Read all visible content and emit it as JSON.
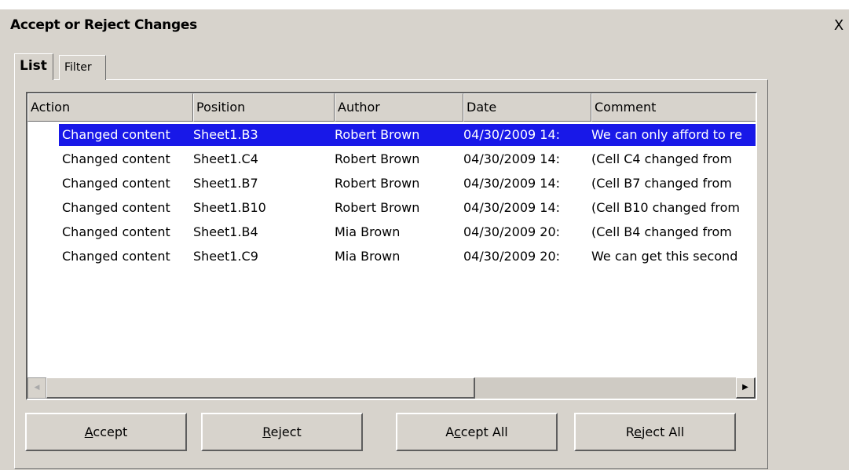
{
  "window": {
    "title": "Accept or Reject Changes",
    "close_glyph": "X"
  },
  "tabs": [
    {
      "label": "List",
      "active": true
    },
    {
      "label": "Filter",
      "active": false
    }
  ],
  "table": {
    "columns": [
      "Action",
      "Position",
      "Author",
      "Date",
      "Comment"
    ],
    "rows": [
      {
        "action": "Changed content",
        "position": "Sheet1.B3",
        "author": "Robert Brown",
        "date": "04/30/2009 14:",
        "comment": "We can only afford to re",
        "selected": true
      },
      {
        "action": "Changed content",
        "position": "Sheet1.C4",
        "author": "Robert Brown",
        "date": "04/30/2009 14:",
        "comment": "(Cell C4 changed from",
        "selected": false
      },
      {
        "action": "Changed content",
        "position": "Sheet1.B7",
        "author": "Robert Brown",
        "date": "04/30/2009 14:",
        "comment": "(Cell B7 changed from",
        "selected": false
      },
      {
        "action": "Changed content",
        "position": "Sheet1.B10",
        "author": "Robert Brown",
        "date": "04/30/2009 14:",
        "comment": "(Cell B10 changed from",
        "selected": false
      },
      {
        "action": "Changed content",
        "position": "Sheet1.B4",
        "author": "Mia Brown",
        "date": "04/30/2009 20:",
        "comment": "(Cell B4 changed from",
        "selected": false
      },
      {
        "action": "Changed content",
        "position": "Sheet1.C9",
        "author": "Mia Brown",
        "date": "04/30/2009 20:",
        "comment": "We can get this second",
        "selected": false
      }
    ]
  },
  "scrollbar": {
    "left_arrow": "◀",
    "right_arrow": "▶"
  },
  "buttons": {
    "accept": {
      "mnemonic": "A",
      "rest": "ccept"
    },
    "reject": {
      "mnemonic": "R",
      "rest": "eject"
    },
    "accept_all": {
      "pre": "A",
      "mnemonic": "c",
      "rest": "cept All"
    },
    "reject_all": {
      "pre": "R",
      "mnemonic": "e",
      "rest": "ject All"
    }
  },
  "colors": {
    "selection": "#1818e8",
    "dialog_bg": "#d7d3cc"
  }
}
